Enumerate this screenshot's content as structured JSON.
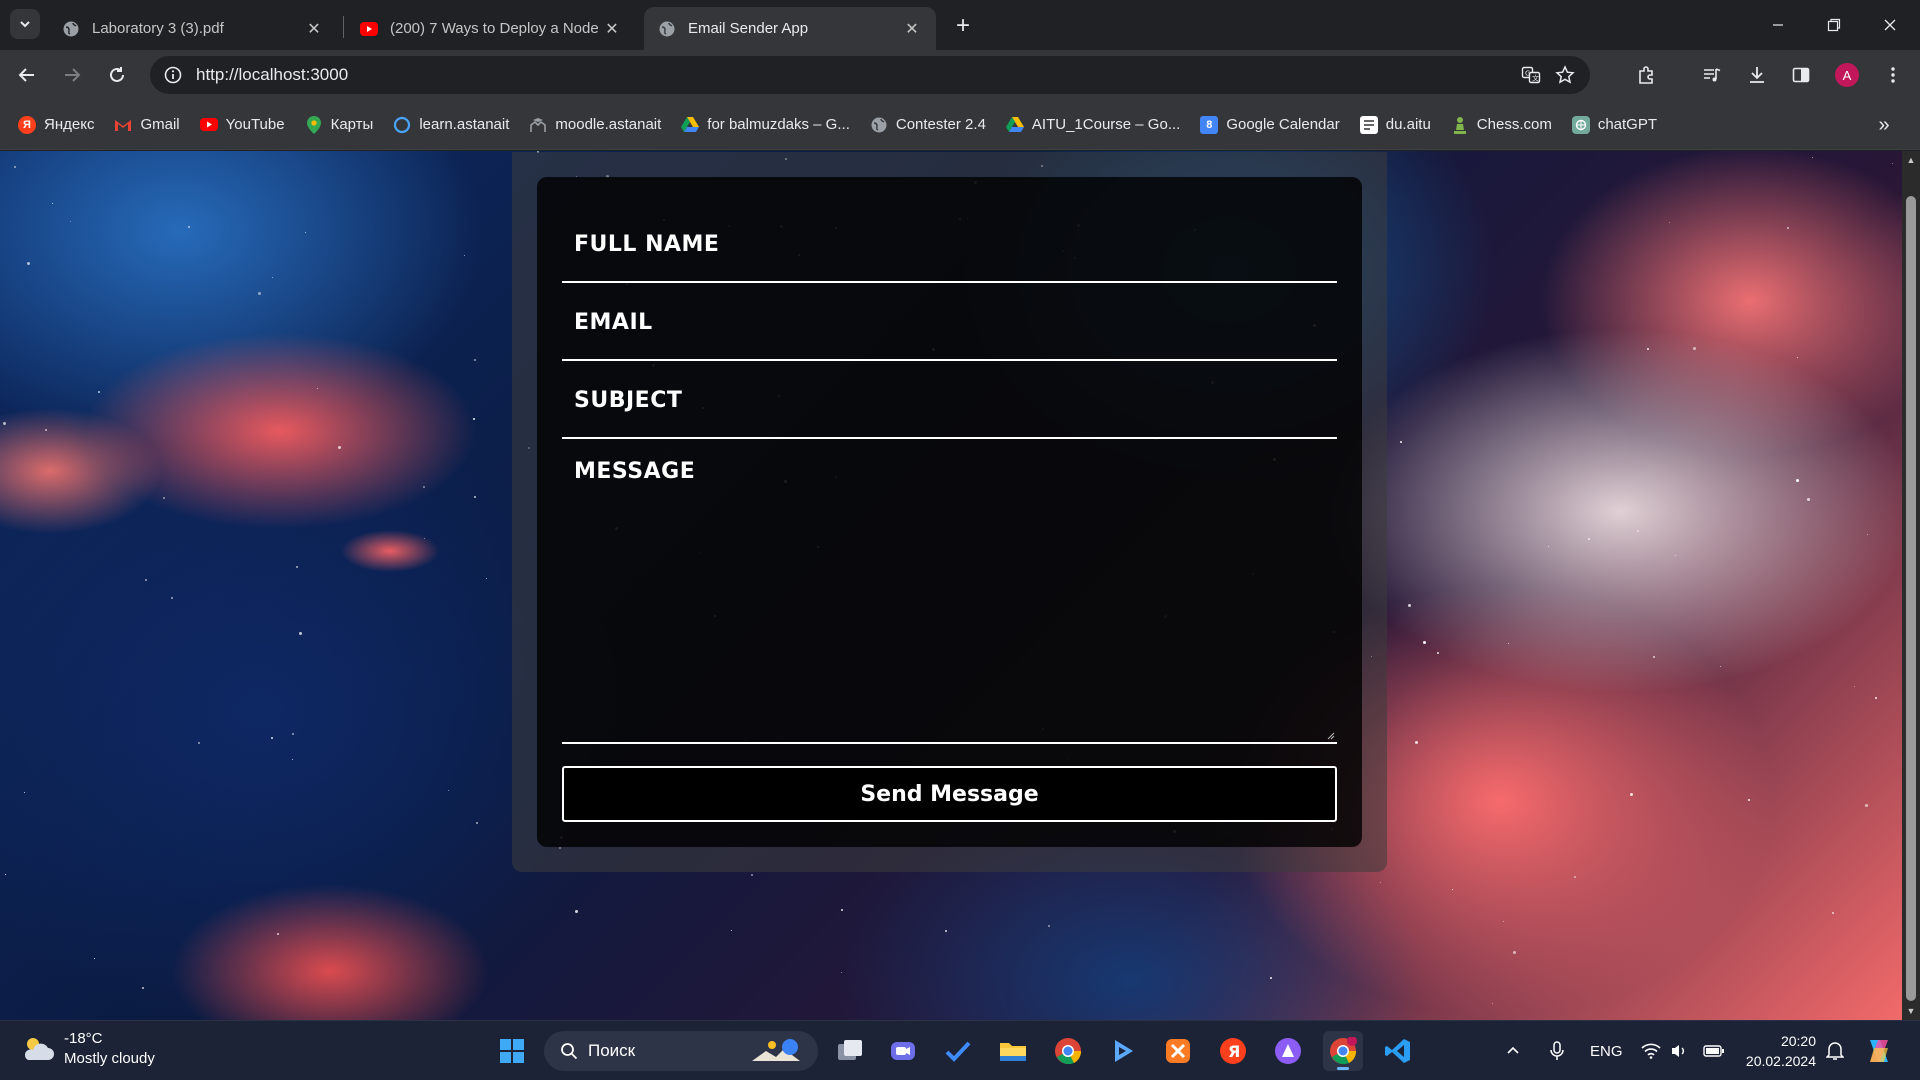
{
  "browser": {
    "tabs": [
      {
        "title": "Laboratory 3 (3).pdf",
        "favicon": "globe-icon",
        "active": false
      },
      {
        "title": "(200) 7 Ways to Deploy a Node",
        "favicon": "youtube-icon",
        "active": false
      },
      {
        "title": "Email Sender App",
        "favicon": "globe-icon",
        "active": true
      }
    ],
    "url": "http://localhost:3000",
    "profile_initial": "A",
    "bookmarks": [
      {
        "label": "Яндекс",
        "icon": "yandex-icon"
      },
      {
        "label": "Gmail",
        "icon": "gmail-icon"
      },
      {
        "label": "YouTube",
        "icon": "youtube-icon"
      },
      {
        "label": "Карты",
        "icon": "maps-icon"
      },
      {
        "label": "learn.astanait",
        "icon": "circle-icon"
      },
      {
        "label": "moodle.astanait",
        "icon": "moodle-icon"
      },
      {
        "label": "for balmuzdaks – G...",
        "icon": "drive-icon"
      },
      {
        "label": "Contester 2.4",
        "icon": "globe-icon"
      },
      {
        "label": "AITU_1Course – Go...",
        "icon": "drive-icon"
      },
      {
        "label": "Google Calendar",
        "icon": "calendar-icon"
      },
      {
        "label": "du.aitu",
        "icon": "doc-icon"
      },
      {
        "label": "Chess.com",
        "icon": "chess-icon"
      },
      {
        "label": "chatGPT",
        "icon": "chatgpt-icon"
      }
    ]
  },
  "form": {
    "full_name_placeholder": "FULL NAME",
    "email_placeholder": "EMAIL",
    "subject_placeholder": "SUBJECT",
    "message_placeholder": "MESSAGE",
    "send_label": "Send Message"
  },
  "taskbar": {
    "weather_temp": "-18°C",
    "weather_desc": "Mostly cloudy",
    "search_label": "Поиск",
    "language": "ENG",
    "time": "20:20",
    "date": "20.02.2024"
  },
  "colors": {
    "page_card": "#000000",
    "form_text": "#ffffff",
    "browser_chrome": "#35363a",
    "taskbar": "#1c2336"
  }
}
